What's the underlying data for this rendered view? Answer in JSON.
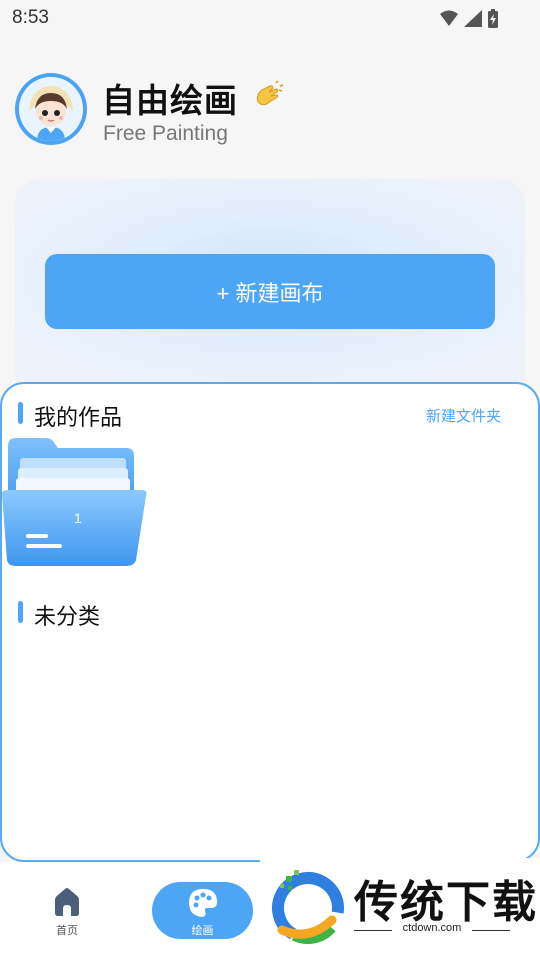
{
  "status_bar": {
    "time": "8:53"
  },
  "header": {
    "title": "自由绘画",
    "subtitle": "Free Painting"
  },
  "hero": {
    "new_canvas_label": "+ 新建画布"
  },
  "works": {
    "section_title": "我的作品",
    "new_folder_label": "新建文件夹",
    "folders": [
      {
        "count": "1"
      }
    ],
    "uncategorized_title": "未分类"
  },
  "bottom_nav": {
    "items": [
      {
        "label": "首页",
        "icon": "home-icon"
      },
      {
        "label": "绘画",
        "icon": "palette-icon",
        "active": true
      }
    ]
  },
  "watermark": {
    "title": "传统下载",
    "url": "ctdown.com"
  },
  "colors": {
    "accent": "#4da6f5",
    "background": "#f6f6f6",
    "panel_border": "#5aaaf2"
  }
}
